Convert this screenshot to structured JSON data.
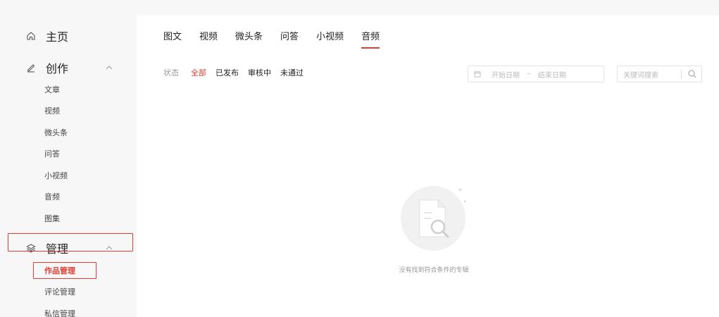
{
  "sidebar": {
    "home": {
      "label": "主页",
      "icon": "home-icon"
    },
    "create": {
      "label": "创作",
      "icon": "pen-icon",
      "items": [
        "文章",
        "视频",
        "微头条",
        "问答",
        "小视频",
        "音频",
        "图集"
      ]
    },
    "manage": {
      "label": "管理",
      "icon": "layers-icon",
      "items": [
        "作品管理",
        "评论管理",
        "私信管理"
      ],
      "active_item": "作品管理"
    }
  },
  "main": {
    "tabs": [
      "图文",
      "视频",
      "微头条",
      "问答",
      "小视频",
      "音频"
    ],
    "active_tab": "音频",
    "filter": {
      "label": "状态",
      "options": [
        "全部",
        "已发布",
        "审核中",
        "未通过"
      ],
      "active": "全部"
    },
    "date_range": {
      "start_placeholder": "开始日期",
      "separator": "~",
      "end_placeholder": "结束日期"
    },
    "search": {
      "placeholder": "关键词搜索"
    },
    "empty_message": "没有找到符合条件的专辑"
  },
  "colors": {
    "accent": "#e33e33",
    "panel": "#ffffff",
    "sidebar_bg": "#f7f7f7"
  }
}
